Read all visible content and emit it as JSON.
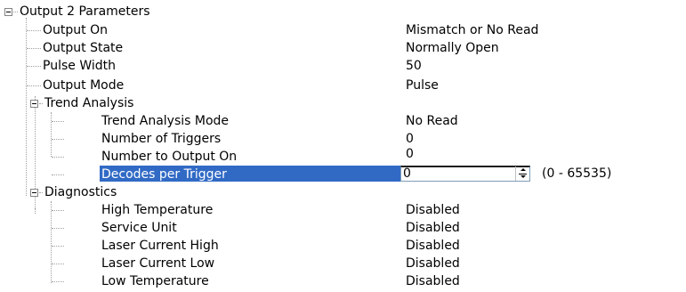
{
  "tree": {
    "output2": {
      "label": "Output 2 Parameters",
      "expander_icon": "collapse-minus-icon",
      "items": [
        {
          "label": "Output On",
          "value": "Mismatch or No Read"
        },
        {
          "label": "Output State",
          "value": "Normally Open"
        },
        {
          "label": "Pulse Width",
          "value": "50"
        },
        {
          "label": "Output Mode",
          "value": "Pulse"
        }
      ],
      "trend_analysis": {
        "label": "Trend Analysis",
        "expander_icon": "collapse-minus-icon",
        "items": [
          {
            "label": "Trend Analysis Mode",
            "value": "No Read"
          },
          {
            "label": "Number of Triggers",
            "value": "0"
          },
          {
            "label": "Number to Output On",
            "value": "0"
          }
        ],
        "selected_item": {
          "label": "Decodes per Trigger",
          "editor_value": "0",
          "range": "(0 - 65535)",
          "spinner_icon": "spin-up-down-icon"
        }
      },
      "diagnostics": {
        "label": "Diagnostics",
        "expander_icon": "collapse-minus-icon",
        "items": [
          {
            "label": "High Temperature",
            "value": "Disabled"
          },
          {
            "label": "Service Unit",
            "value": "Disabled"
          },
          {
            "label": "Laser Current High",
            "value": "Disabled"
          },
          {
            "label": "Laser Current Low",
            "value": "Disabled"
          },
          {
            "label": "Low Temperature",
            "value": "Disabled"
          }
        ]
      }
    }
  },
  "colors": {
    "selection": "#316ac5",
    "tree_lines": "#a0a0a0",
    "expander_border": "#848484"
  }
}
